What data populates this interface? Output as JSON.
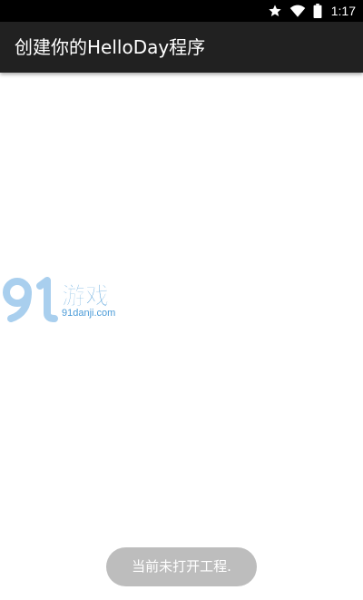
{
  "status_bar": {
    "time": "1:17",
    "icons": [
      "star-icon",
      "wifi-icon",
      "battery-icon"
    ]
  },
  "app_bar": {
    "title": "创建你的HelloDay程序"
  },
  "watermark": {
    "logo_text": "91游戏",
    "url_text": "91danji.com",
    "color": "#4a9bd8"
  },
  "toast": {
    "message": "当前未打开工程."
  },
  "colors": {
    "status_bar": "#000000",
    "app_bar": "#212121",
    "background": "#ffffff",
    "toast": "#bdbdbd"
  }
}
